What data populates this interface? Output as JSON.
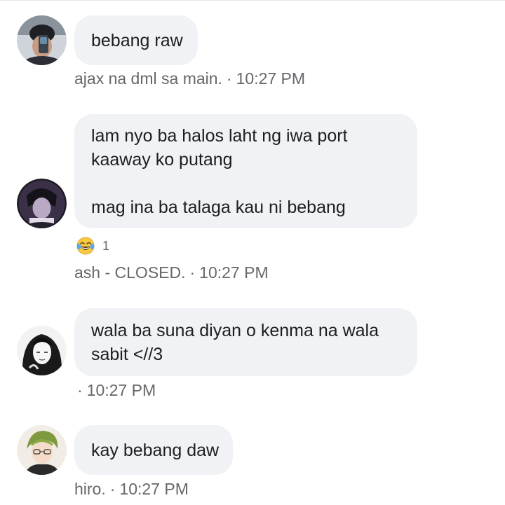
{
  "messages": [
    {
      "text_lines": [
        "bebang raw"
      ],
      "sender": "ajax na dml sa main.",
      "separator": "·",
      "time": "10:27 PM"
    },
    {
      "text_lines": [
        "lam nyo ba halos laht ng iwa port",
        "kaaway ko putang",
        "",
        "mag ina ba talaga kau ni bebang"
      ],
      "sender": "ash - CLOSED.",
      "separator": "·",
      "time": "10:27 PM",
      "reaction": {
        "emoji": "😂",
        "icon": "laughing-tears-emoji",
        "count": "1"
      }
    },
    {
      "text_lines": [
        "wala ba suna diyan o kenma na wala",
        "sabit <//3"
      ],
      "sender": "",
      "separator": "·",
      "time": "10:27 PM"
    },
    {
      "text_lines": [
        "kay bebang daw"
      ],
      "sender": "hiro.",
      "separator": "·",
      "time": "10:27 PM"
    }
  ],
  "colors": {
    "bubble_bg": "#f0f2f5",
    "text": "#1c1e21",
    "meta": "#65676b"
  }
}
